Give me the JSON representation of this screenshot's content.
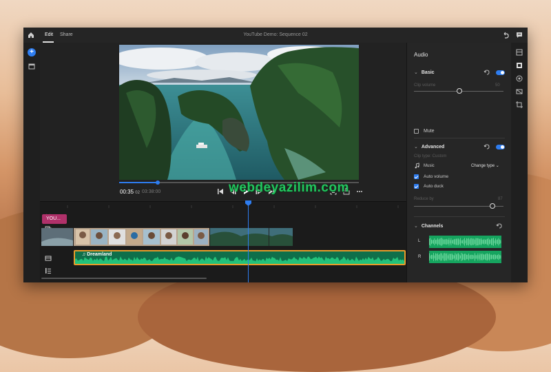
{
  "header": {
    "tabs": [
      {
        "label": "Edit",
        "active": true
      },
      {
        "label": "Share",
        "active": false
      }
    ],
    "sequence_title": "YouTube Demo: Sequence 02"
  },
  "preview": {
    "current_time": "00:35",
    "current_frames": "02",
    "duration": "03:38:00",
    "playback_progress": 0.16
  },
  "timeline": {
    "title_clip_label": "YOU...",
    "audio_clip_name": "Dreamland",
    "playhead_progress": 0.5
  },
  "watermark": "webdeyazilim.com",
  "audio_panel": {
    "title": "Audio",
    "basic": {
      "label": "Basic",
      "enabled": true,
      "clip_volume_label": "Clip volume",
      "clip_volume_value": "50",
      "clip_volume_level": 0.5,
      "mute_label": "Mute",
      "mute_checked": false
    },
    "advanced": {
      "label": "Advanced",
      "enabled": true,
      "hint": "Clip type: Custom",
      "type_label": "Music",
      "type_select": "Change type",
      "auto_volume_label": "Auto volume",
      "auto_volume_checked": true,
      "auto_duck_label": "Auto duck",
      "auto_duck_checked": true,
      "reduce_by_label": "Reduce by",
      "reduce_by_value": "87",
      "reduce_by_level": 0.87
    },
    "channels": {
      "label": "Channels",
      "left": "L",
      "right": "R"
    }
  },
  "colors": {
    "accent": "#2e7df0",
    "audio_clip": "#0f6f4a",
    "audio_border": "#e99c2b",
    "title_clip": "#b0316a",
    "channel_wave": "#16a45f",
    "watermark": "#22c55e"
  }
}
